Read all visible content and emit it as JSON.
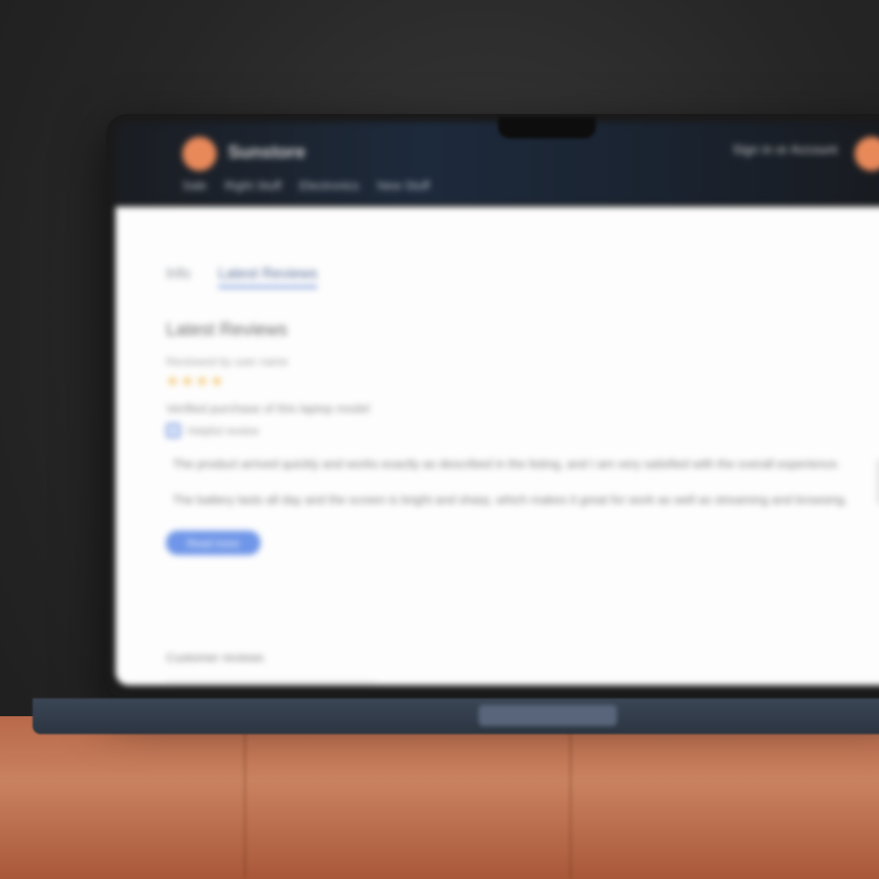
{
  "header": {
    "brand": "Sunstore",
    "user_label": "Sign in or Account",
    "nav_items": [
      "Sale",
      "Right Stuff",
      "Electronics",
      "New Stuff"
    ]
  },
  "tabs": [
    {
      "label": "Info",
      "active": false
    },
    {
      "label": "Latest Reviews",
      "active": true
    }
  ],
  "product": {
    "title": "Latest Reviews",
    "meta": "Reviewed by user name",
    "rating_stars": "★★★★",
    "info": "Verified purchase of this laptop model",
    "checkbox_label": "Helpful review"
  },
  "description": {
    "line1": "The product arrived quickly and works exactly as described in the listing, and I am very satisfied with the overall experience.",
    "line2": "The battery lasts all day and the screen is bright and sharp, which makes it great for work as well as streaming and browsing."
  },
  "action_button": "Read more",
  "footer_tab": "Customer reviews",
  "colors": {
    "accent": "#6f96e8",
    "brand_orange": "#e8895a",
    "star": "#f2c46b"
  }
}
